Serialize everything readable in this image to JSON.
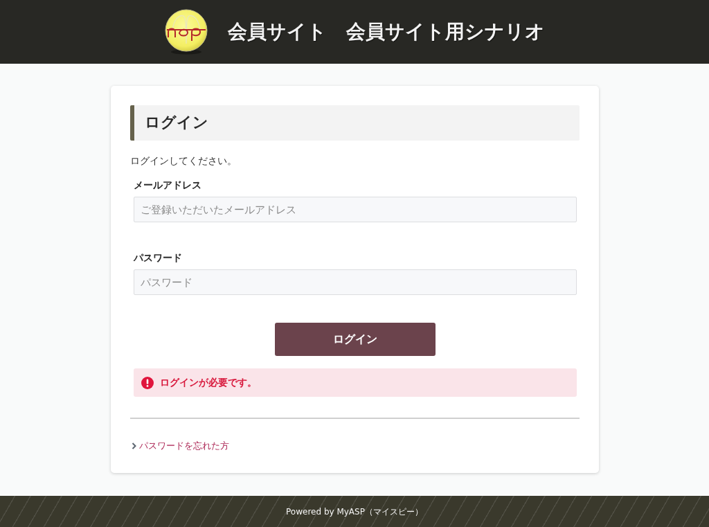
{
  "header": {
    "title": "会員サイト　会員サイト用シナリオ"
  },
  "login_card": {
    "heading": "ログイン",
    "instruction": "ログインしてください。",
    "fields": [
      {
        "label": "メールアドレス",
        "placeholder": "ご登録いただいたメールアドレス"
      },
      {
        "label": "パスワード",
        "placeholder": "パスワード"
      }
    ],
    "submit_button": "ログイン",
    "alert": {
      "kind": "error",
      "message": "ログインが必要です。"
    },
    "forgot_link": "パスワードを忘れた方"
  },
  "footer": {
    "text": "Powered by MyASP（マイスピー）"
  }
}
